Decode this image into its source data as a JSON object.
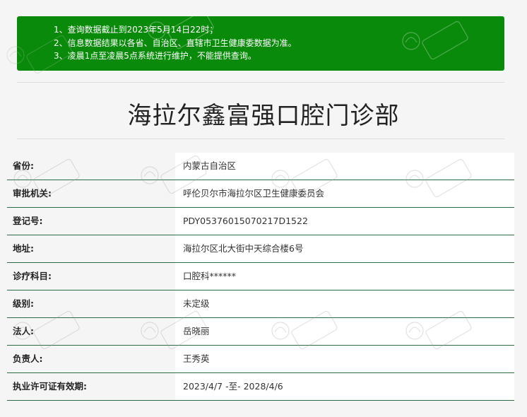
{
  "notice": {
    "lines": [
      "1、查询数据截止到2023年5月14日22时；",
      "2、信息数据结果以各省、自治区、直辖市卫生健康委数据为准。",
      "3、凌晨1点至凌晨5点系统进行维护，不能提供查询。"
    ],
    "background_color": "#0a8a0a"
  },
  "page_title": "海拉尔鑫富强口腔门诊部",
  "table": {
    "rows": [
      {
        "label": "省份:",
        "value": "内蒙古自治区"
      },
      {
        "label": "审批机关:",
        "value": "呼伦贝尔市海拉尔区卫生健康委员会"
      },
      {
        "label": "登记号:",
        "value": "PDY05376015070217D1522"
      },
      {
        "label": "地址:",
        "value": "海拉尔区北大街中天综合楼6号"
      },
      {
        "label": "诊疗科目:",
        "value": "口腔科******"
      },
      {
        "label": "级别:",
        "value": "未定级"
      },
      {
        "label": "法人:",
        "value": "岳晓丽"
      },
      {
        "label": "负责人:",
        "value": "王秀英"
      },
      {
        "label": "执业许可证有效期:",
        "value": "2023/4/7 -至- 2028/4/6"
      }
    ],
    "border_color": "#2d6b45"
  }
}
